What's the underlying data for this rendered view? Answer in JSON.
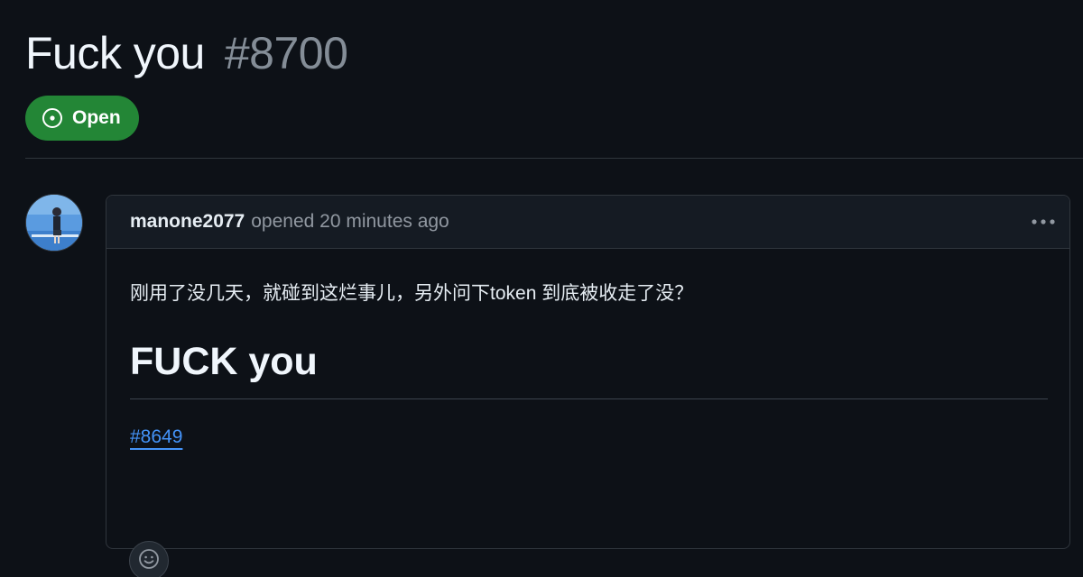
{
  "issue": {
    "title": "Fuck you",
    "number": "#8700",
    "state": "Open"
  },
  "comment": {
    "author": "manone2077",
    "meta": "opened 20 minutes ago",
    "body_text": "刚用了没几天，就碰到这烂事儿，另外问下token 到底被收走了没？",
    "heading": "FUCK you",
    "linked_issue": "#8649"
  },
  "icons": {
    "state": "issue-opened-icon",
    "more": "kebab-horizontal-icon",
    "reaction": "smiley-icon"
  },
  "colors": {
    "background": "#0d1117",
    "open_badge": "#238636",
    "link": "#4493f8",
    "muted": "#9198a1"
  }
}
